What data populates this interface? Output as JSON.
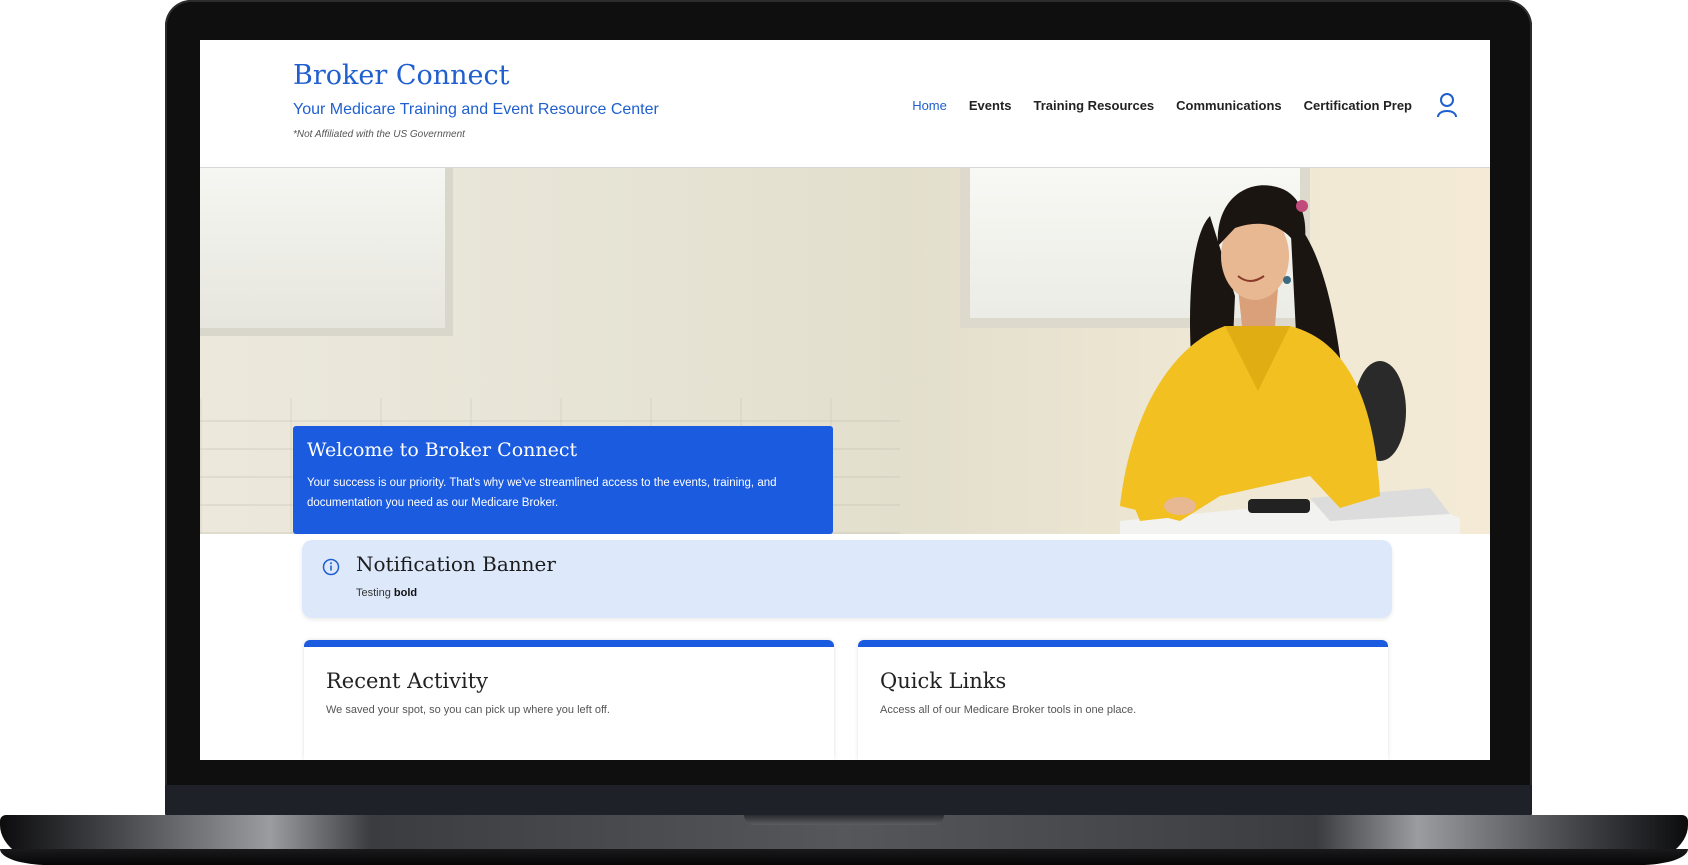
{
  "brand": {
    "title": "Broker Connect",
    "subtitle": "Your Medicare Training and Event Resource Center",
    "disclaimer": "*Not Affiliated with the US Government"
  },
  "nav": {
    "items": [
      "Home",
      "Events",
      "Training Resources",
      "Communications",
      "Certification Prep"
    ],
    "active": "Home",
    "user_icon": "user-icon"
  },
  "hero": {
    "title": "Welcome to Broker Connect",
    "text": "Your success is our priority. That's why we've streamlined access to the events, training, and documentation you need as our Medicare Broker."
  },
  "notification": {
    "icon": "info-icon",
    "title": "Notification Banner",
    "text_prefix": "Testing ",
    "text_bold": "bold"
  },
  "cards": [
    {
      "title": "Recent Activity",
      "text": "We saved your spot, so you can pick up where you left off."
    },
    {
      "title": "Quick Links",
      "text": "Access all of our Medicare Broker tools in one place."
    }
  ],
  "colors": {
    "brand_blue": "#1f5fcf",
    "hero_box": "#1a5be0",
    "notification_bg": "#dde9fb"
  }
}
